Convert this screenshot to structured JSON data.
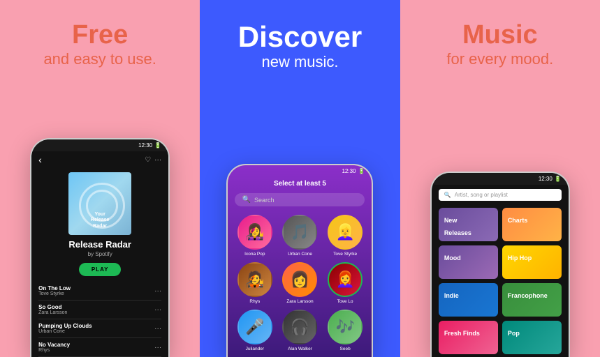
{
  "panels": {
    "left": {
      "title": "Free",
      "subtitle": "and easy to use."
    },
    "center": {
      "title": "Discover",
      "subtitle": "new music."
    },
    "right": {
      "title": "Music",
      "subtitle": "for every mood."
    }
  },
  "left_phone": {
    "status_time": "12:30",
    "album_label": "Your\nRelease\nRadar",
    "title": "Release Radar",
    "by": "by Spotify",
    "play_label": "PLAY",
    "tracks": [
      {
        "name": "On The Low",
        "artist": "Tove Styrke"
      },
      {
        "name": "So Good",
        "artist": "Zara Larsson"
      },
      {
        "name": "Pumping Up Clouds",
        "artist": "Urban Cone"
      },
      {
        "name": "No Vacancy",
        "artist": "Rhys"
      }
    ]
  },
  "center_phone": {
    "status_time": "12:30",
    "select_label": "Select at least 5",
    "search_placeholder": "Search",
    "artists": [
      {
        "name": "Icona Pop",
        "color_class": "ac1",
        "selected": false
      },
      {
        "name": "Urban Cone",
        "color_class": "ac2",
        "selected": false
      },
      {
        "name": "Tove Styrke",
        "color_class": "ac3",
        "selected": false
      },
      {
        "name": "Rhys",
        "color_class": "ac4",
        "selected": false
      },
      {
        "name": "Zara Larsson",
        "color_class": "ac5",
        "selected": false
      },
      {
        "name": "Tove Lo",
        "color_class": "ac6",
        "selected": true
      },
      {
        "name": "Juliander",
        "color_class": "ac7",
        "selected": false
      },
      {
        "name": "Alan Walker",
        "color_class": "ac8",
        "selected": false
      },
      {
        "name": "Seeb",
        "color_class": "ac9",
        "selected": false
      }
    ]
  },
  "right_phone": {
    "status_time": "12:30",
    "search_placeholder": "Artist, song or playlist",
    "categories": [
      {
        "label": "New Releases",
        "color_class": "cat-new-releases"
      },
      {
        "label": "Charts",
        "color_class": "cat-charts"
      },
      {
        "label": "Mood",
        "color_class": "cat-mood"
      },
      {
        "label": "Hip Hop",
        "color_class": "cat-hip-hop"
      },
      {
        "label": "Indie",
        "color_class": "cat-indie"
      },
      {
        "label": "Francophone",
        "color_class": "cat-francophone"
      },
      {
        "label": "Fresh Finds",
        "color_class": "cat-fresh-finds"
      },
      {
        "label": "Pop",
        "color_class": "cat-pop"
      }
    ]
  }
}
